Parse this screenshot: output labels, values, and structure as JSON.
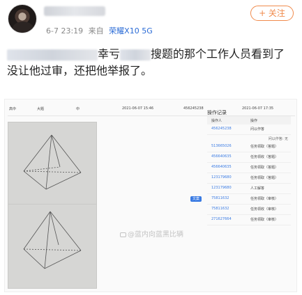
{
  "post": {
    "timestamp": "6-7 23:19",
    "source_prefix": "来自",
    "device": "荣耀X10 5G",
    "follow_label": "+ 关注",
    "text_part1": "幸亏",
    "text_part2": "搜题的那个工作人员看到了",
    "text_line2": "没让他过审，还把他举报了。"
  },
  "screenshot": {
    "row": {
      "grade": "高中",
      "type": "大题",
      "level": "中",
      "time1": "2021-06-07 15:46",
      "id": "456245238",
      "time2": "2021-06-07 17:35"
    },
    "badge": "文案",
    "log_title": "操作记录",
    "log_headers": [
      "操作人",
      "操作"
    ],
    "log_rows": [
      {
        "id": "456245238",
        "action": "问以作答"
      },
      {
        "sub": "问以作答: 无"
      },
      {
        "id": "513665026",
        "action": "任务领取（答题）"
      },
      {
        "id": "456640635",
        "action": "任务领收（答题）"
      },
      {
        "id": "456640635",
        "action": "任务领取（答题）"
      },
      {
        "id": "123179680",
        "action": "任务领取（答题）"
      },
      {
        "id": "123179680",
        "action": "人工解答"
      },
      {
        "id": "75811632",
        "action": "任务领取（审核）"
      },
      {
        "id": "75811632",
        "action": "任务领收（审核）"
      },
      {
        "id": "271627664",
        "action": "任务领取（审核）"
      }
    ],
    "watermark": "@蓝内向蓝黑比辆"
  },
  "colors": {
    "follow": "#f08a4b",
    "link": "#2a6bd6",
    "id_blue": "#3a7be3"
  }
}
